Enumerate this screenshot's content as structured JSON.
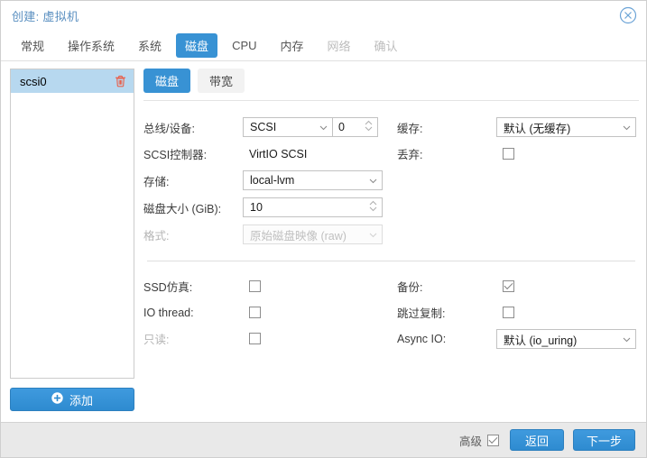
{
  "window": {
    "title": "创建: 虚拟机",
    "close_icon": "close-circle-icon"
  },
  "tabs": [
    {
      "label": "常规",
      "state": "normal"
    },
    {
      "label": "操作系统",
      "state": "normal"
    },
    {
      "label": "系统",
      "state": "normal"
    },
    {
      "label": "磁盘",
      "state": "active"
    },
    {
      "label": "CPU",
      "state": "normal"
    },
    {
      "label": "内存",
      "state": "normal"
    },
    {
      "label": "网络",
      "state": "disabled"
    },
    {
      "label": "确认",
      "state": "disabled"
    }
  ],
  "sidebar": {
    "devices": [
      {
        "label": "scsi0",
        "selected": true,
        "delete_icon": "trash-icon"
      }
    ],
    "add_button": {
      "label": "添加",
      "icon": "plus-circle-icon"
    }
  },
  "subtabs": [
    {
      "label": "磁盘",
      "state": "active"
    },
    {
      "label": "带宽",
      "state": "normal"
    }
  ],
  "form": {
    "left": {
      "bus_device": {
        "label": "总线/设备:",
        "select_value": "SCSI",
        "spinner_value": "0"
      },
      "scsi_controller": {
        "label": "SCSI控制器:",
        "value": "VirtIO SCSI"
      },
      "storage": {
        "label": "存储:",
        "value": "local-lvm"
      },
      "disk_size": {
        "label": "磁盘大小 (GiB):",
        "value": "10"
      },
      "format": {
        "label": "格式:",
        "value": "原始磁盘映像 (raw)",
        "disabled": true
      },
      "ssd_emulation": {
        "label": "SSD仿真:",
        "checked": false
      },
      "io_thread": {
        "label": "IO thread:",
        "checked": false
      },
      "readonly": {
        "label": "只读:",
        "checked": false,
        "disabled": true
      }
    },
    "right": {
      "cache": {
        "label": "缓存:",
        "value": "默认 (无缓存)"
      },
      "discard": {
        "label": "丢弃:",
        "checked": false
      },
      "backup": {
        "label": "备份:",
        "checked": true
      },
      "skip_repl": {
        "label": "跳过复制:",
        "checked": false
      },
      "async_io": {
        "label": "Async IO:",
        "value": "默认 (io_uring)"
      }
    }
  },
  "footer": {
    "advanced_label": "高级",
    "advanced_checked": true,
    "back_label": "返回",
    "next_label": "下一步"
  },
  "colors": {
    "accent": "#3892d4",
    "selection": "#b7d8ef",
    "title": "#5a8fc0",
    "danger": "#e8604c",
    "footer_bg": "#e9e9e9"
  }
}
